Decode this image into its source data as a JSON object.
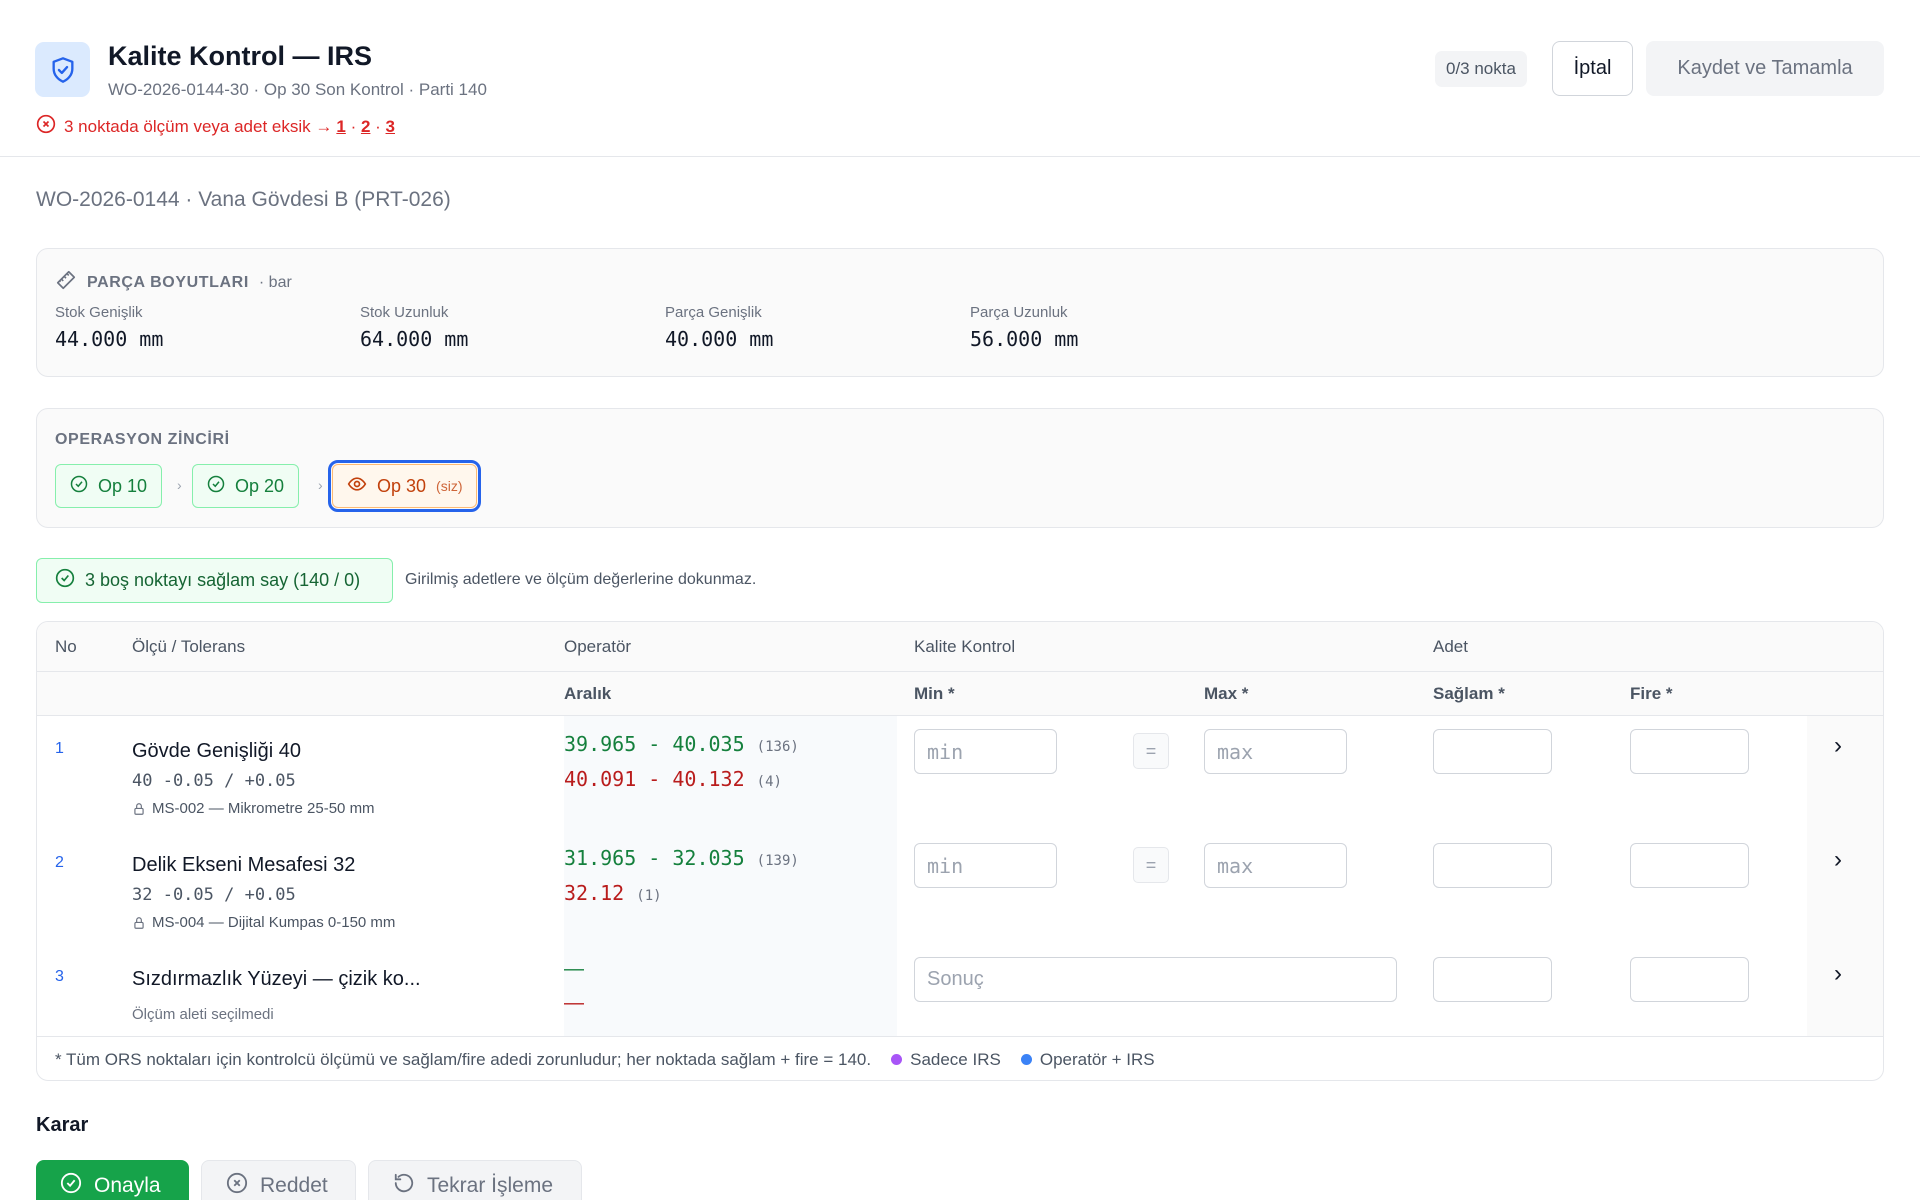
{
  "header": {
    "title": "Kalite Kontrol — IRS",
    "subtitle": "WO-2026-0144-30 · Op 30 Son Kontrol · Parti 140",
    "warning_text": "3 noktada ölçüm veya adet eksik →",
    "warning_links": [
      "1",
      "2",
      "3"
    ],
    "count_badge": "0/3 nokta",
    "cancel_label": "İptal",
    "save_label": "Kaydet ve Tamamla"
  },
  "work_order_line": "WO-2026-0144 · Vana Gövdesi B (PRT-026)",
  "dimensions": {
    "heading": "PARÇA BOYUTLARI",
    "unit": "· bar",
    "items": [
      {
        "label": "Stok Genişlik",
        "value": "44.000 mm"
      },
      {
        "label": "Stok Uzunluk",
        "value": "64.000 mm"
      },
      {
        "label": "Parça Genişlik",
        "value": "40.000 mm"
      },
      {
        "label": "Parça Uzunluk",
        "value": "56.000 mm"
      }
    ]
  },
  "op_chain": {
    "heading": "OPERASYON ZİNCİRİ",
    "steps": [
      {
        "label": "Op 10",
        "status": "done"
      },
      {
        "label": "Op 20",
        "status": "done"
      },
      {
        "label": "Op 30",
        "status": "current",
        "tag": "(siz)"
      }
    ]
  },
  "mark_all": {
    "label": "3 boş noktayı sağlam say (140 / 0)",
    "note": "Girilmiş adetlere ve ölçüm değerlerine dokunmaz."
  },
  "table": {
    "header_top": {
      "no": "No",
      "measure": "Ölçü / Tolerans",
      "operator": "Operatör",
      "qc": "Kalite Kontrol",
      "qty": "Adet"
    },
    "header_sub": {
      "range": "Aralık",
      "min": "Min *",
      "max": "Max *",
      "good": "Sağlam *",
      "scrap": "Fire *"
    },
    "rows": [
      {
        "no": "1",
        "name": "Gövde Genişliği 40",
        "tolerance": "40 -0.05 / +0.05",
        "tool": "MS-002 — Mikrometre 25-50 mm",
        "ranges": [
          {
            "text": "39.965 - 40.035",
            "count": "(136)",
            "status": "ok"
          },
          {
            "text": "40.091 - 40.132",
            "count": "(4)",
            "status": "nok"
          }
        ],
        "min_placeholder": "min",
        "max_placeholder": "max"
      },
      {
        "no": "2",
        "name": "Delik Ekseni Mesafesi 32",
        "tolerance": "32 -0.05 / +0.05",
        "tool": "MS-004 — Dijital Kumpas 0-150 mm",
        "ranges": [
          {
            "text": "31.965 - 32.035",
            "count": "(139)",
            "status": "ok"
          },
          {
            "text": "32.12",
            "count": "(1)",
            "status": "nok"
          }
        ],
        "min_placeholder": "min",
        "max_placeholder": "max"
      },
      {
        "no": "3",
        "name": "Sızdırmazlık Yüzeyi — çizik ko...",
        "tool": "Ölçüm aleti seçilmedi",
        "ranges": [
          {
            "text": "—",
            "count": "",
            "status": "ok"
          },
          {
            "text": "—",
            "count": "",
            "status": "nok"
          }
        ],
        "result_placeholder": "Sonuç"
      }
    ],
    "eq_symbol": "=",
    "footnote": "* Tüm ORS noktaları için kontrolcü ölçümü ve sağlam/fire adedi zorunludur; her noktada sağlam + fire = 140.",
    "legend": [
      {
        "label": "Sadece IRS",
        "color": "#a855f7"
      },
      {
        "label": "Operatör + IRS",
        "color": "#3b82f6"
      }
    ]
  },
  "decision": {
    "title": "Karar",
    "approve": "Onayla",
    "reject": "Reddet",
    "rework": "Tekrar İşleme"
  },
  "colors": {
    "accent": "#2563eb",
    "ok": "#15803d",
    "nok": "#b91c1c",
    "approve": "#16a34a"
  }
}
